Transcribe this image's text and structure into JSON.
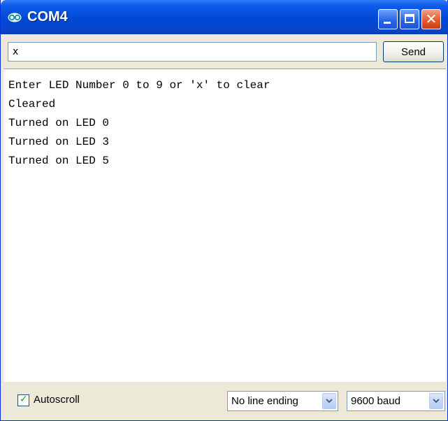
{
  "window": {
    "title": "COM4",
    "app_icon": "arduino-icon",
    "controls": [
      "minimize-icon",
      "maximize-icon",
      "close-icon"
    ]
  },
  "input": {
    "value": "x",
    "send_label": "Send"
  },
  "output": {
    "lines": [
      "Enter LED Number 0 to 9 or 'x' to clear",
      "Cleared",
      "Turned on LED 0",
      "Turned on LED 3",
      "Turned on LED 5"
    ]
  },
  "footer": {
    "autoscroll_label": "Autoscroll",
    "autoscroll_checked": true,
    "line_ending": "No line ending",
    "baud_rate": "9600 baud"
  },
  "colors": {
    "titlebar": "#0a46cf",
    "close_button": "#e35c2e",
    "window_bg": "#ece9d8"
  }
}
